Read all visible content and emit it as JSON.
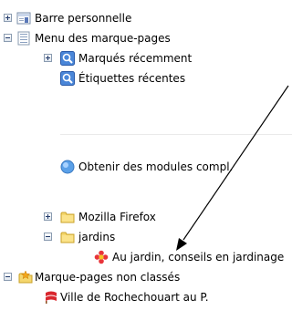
{
  "tree": {
    "items": [
      {
        "label": "Barre personnelle",
        "expander": "plus",
        "icon": "bookmarks-toolbar-icon"
      },
      {
        "label": "Menu des marque-pages",
        "expander": "minus",
        "icon": "bookmarks-menu-icon"
      },
      {
        "label": "Marqués récemment",
        "expander": "plus",
        "icon": "recently-bookmarked-icon"
      },
      {
        "label": "Étiquettes récentes",
        "expander": "",
        "icon": "recent-tags-icon"
      },
      {
        "label": "Obtenir des modules compl.",
        "expander": "",
        "icon": "get-addons-icon"
      },
      {
        "label": "Mozilla Firefox",
        "expander": "plus",
        "icon": "folder-icon"
      },
      {
        "label": "jardins",
        "expander": "minus",
        "icon": "folder-icon"
      },
      {
        "label": "Au jardin, conseils en jardinage",
        "expander": "",
        "icon": "flower-favicon-icon"
      },
      {
        "label": "Marque-pages non classés",
        "expander": "minus",
        "icon": "unsorted-bookmarks-icon"
      },
      {
        "label": "Ville de Rochechouart au P.",
        "expander": "",
        "icon": "town-favicon-icon"
      }
    ]
  }
}
